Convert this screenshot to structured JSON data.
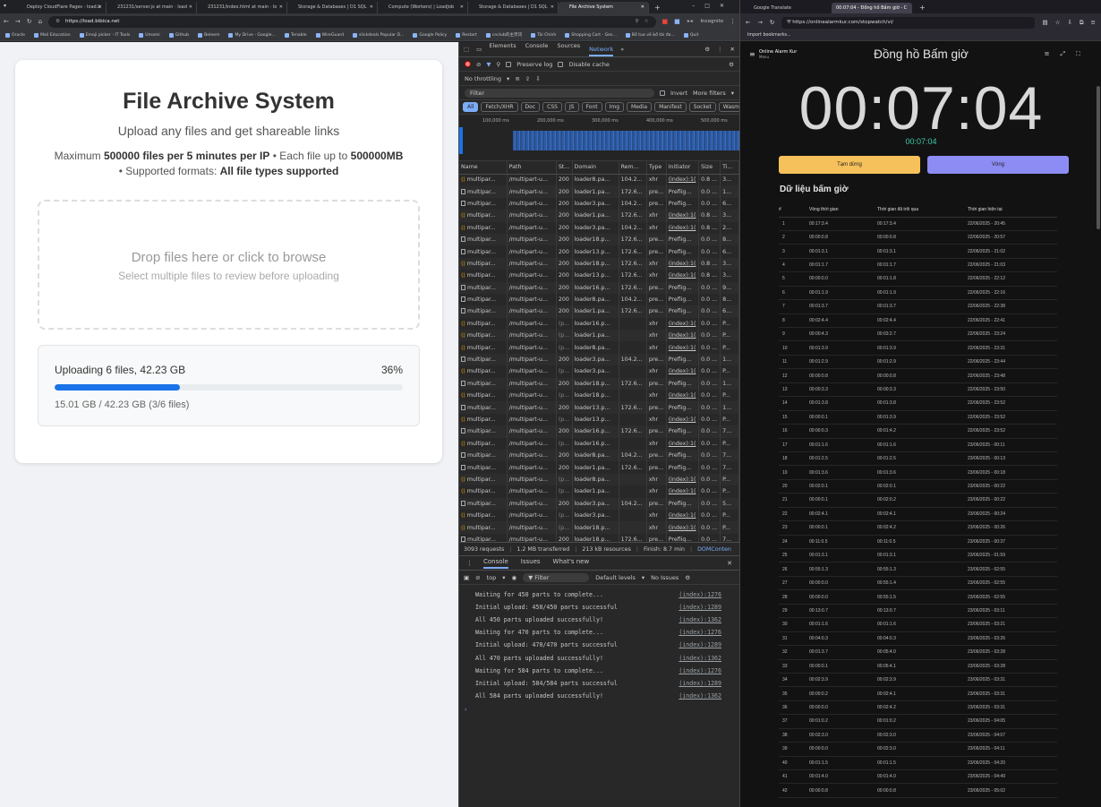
{
  "browser": {
    "tabs": [
      {
        "label": "Deploy CloudFlare Pages - load.b"
      },
      {
        "label": "231231/server.js at main · load"
      },
      {
        "label": "231231/index.html at main · lo"
      },
      {
        "label": "Storage & Databases | D1 SQL"
      },
      {
        "label": "Compute (Workers) | LoadJob"
      },
      {
        "label": "Storage & Databases | D1 SQL"
      },
      {
        "label": "File Archive System",
        "active": true
      }
    ],
    "url": "https://load.bibica.net",
    "incognito": "Incognito",
    "bookmarks": [
      "Oracle",
      "Mail Education",
      "Emoji picker - IT Tools",
      "Umami",
      "Github",
      "Beleem",
      "My Drive - Google...",
      "Tenable",
      "WireGuard",
      "slickdeals Popular D...",
      "Google Policy",
      "Restart",
      "cnclub的主页讯",
      "Tài Chính",
      "Shopping Cart - Ges...",
      "Bổ tua về bổ tài đa...",
      "Quit"
    ]
  },
  "app": {
    "title": "File Archive System",
    "subtitle": "Upload any files and get shareable links",
    "info_pre": "Maximum ",
    "info_files": "500000 files per 5 minutes per IP",
    "info_mid": " • Each file up to ",
    "info_size": "500000MB",
    "info_post": " • Supported formats: ",
    "info_formats": "All file types supported",
    "drop_title": "Drop files here or click to browse",
    "drop_sub": "Select multiple files to review before uploading",
    "progress_label": "Uploading 6 files, 42.23 GB",
    "progress_percent": "36%",
    "progress_value": 0.36,
    "progress_detail": "15.01 GB / 42.23 GB (3/6 files)"
  },
  "devtools": {
    "tabs": [
      "Elements",
      "Console",
      "Sources",
      "Network"
    ],
    "active_tab": "Network",
    "preserve_log": "Preserve log",
    "disable_cache": "Disable cache",
    "throttling": "No throttling",
    "filter_placeholder": "Filter",
    "invert": "Invert",
    "more_filters": "More filters",
    "type_filters": [
      "All",
      "Fetch/XHR",
      "Doc",
      "CSS",
      "JS",
      "Font",
      "Img",
      "Media",
      "Manifest",
      "Socket",
      "Wasm"
    ],
    "timeline_ticks": [
      "100,000 ms",
      "200,000 ms",
      "300,000 ms",
      "400,000 ms",
      "500,000 ms"
    ],
    "columns": [
      "Name",
      "Path",
      "St...",
      "Domain",
      "Rem...",
      "Type",
      "Initiator",
      "Size",
      "Ti..."
    ],
    "rows": [
      [
        "multipar...",
        "/multipart-u...",
        "200",
        "loader8.pa...",
        "104.2...",
        "xhr",
        "(index):1(",
        "0.8 ...",
        "3..."
      ],
      [
        "multipar...",
        "/multipart-u...",
        "200",
        "loader1.pa...",
        "172.6...",
        "pre...",
        "Preflig...",
        "0.0 ...",
        "1..."
      ],
      [
        "multipar...",
        "/multipart-u...",
        "200",
        "loader3.pa...",
        "104.2...",
        "pre...",
        "Preflig...",
        "0.0 ...",
        "6..."
      ],
      [
        "multipar...",
        "/multipart-u...",
        "200",
        "loader1.pa...",
        "172.6...",
        "xhr",
        "(index):1(",
        "0.8 ...",
        "3..."
      ],
      [
        "multipar...",
        "/multipart-u...",
        "200",
        "loader3.pa...",
        "104.2...",
        "xhr",
        "(index):1(",
        "0.8 ...",
        "2..."
      ],
      [
        "multipar...",
        "/multipart-u...",
        "200",
        "loader18.p...",
        "172.6...",
        "pre...",
        "Preflig...",
        "0.0 ...",
        "8..."
      ],
      [
        "multipar...",
        "/multipart-u...",
        "200",
        "loader13.p...",
        "172.6...",
        "pre...",
        "Preflig...",
        "0.0 ...",
        "6..."
      ],
      [
        "multipar...",
        "/multipart-u...",
        "200",
        "loader18.p...",
        "172.6...",
        "xhr",
        "(index):1(",
        "0.8 ...",
        "3..."
      ],
      [
        "multipar...",
        "/multipart-u...",
        "200",
        "loader13.p...",
        "172.6...",
        "xhr",
        "(index):1(",
        "0.8 ...",
        "3..."
      ],
      [
        "multipar...",
        "/multipart-u...",
        "200",
        "loader16.p...",
        "172.6...",
        "pre...",
        "Preflig...",
        "0.0 ...",
        "9..."
      ],
      [
        "multipar...",
        "/multipart-u...",
        "200",
        "loader8.pa...",
        "104.2...",
        "pre...",
        "Preflig...",
        "0.0 ...",
        "8..."
      ],
      [
        "multipar...",
        "/multipart-u...",
        "200",
        "loader1.pa...",
        "172.6...",
        "pre...",
        "Preflig...",
        "0.0 ...",
        "6..."
      ],
      [
        "multipar...",
        "/multipart-u...",
        "(p...",
        "loader16.p...",
        "",
        "xhr",
        "(index):1(",
        "0.0 ...",
        "P..."
      ],
      [
        "multipar...",
        "/multipart-u...",
        "(p...",
        "loader1.pa...",
        "",
        "xhr",
        "(index):1(",
        "0.0 ...",
        "P..."
      ],
      [
        "multipar...",
        "/multipart-u...",
        "(p...",
        "loader8.pa...",
        "",
        "xhr",
        "(index):1(",
        "0.0 ...",
        "P..."
      ],
      [
        "multipar...",
        "/multipart-u...",
        "200",
        "loader3.pa...",
        "104.2...",
        "pre...",
        "Preflig...",
        "0.0 ...",
        "1..."
      ],
      [
        "multipar...",
        "/multipart-u...",
        "(p...",
        "loader3.pa...",
        "",
        "xhr",
        "(index):1(",
        "0.0 ...",
        "P..."
      ],
      [
        "multipar...",
        "/multipart-u...",
        "200",
        "loader18.p...",
        "172.6...",
        "pre...",
        "Preflig...",
        "0.0 ...",
        "1..."
      ],
      [
        "multipar...",
        "/multipart-u...",
        "(p...",
        "loader18.p...",
        "",
        "xhr",
        "(index):1(",
        "0.0 ...",
        "P..."
      ],
      [
        "multipar...",
        "/multipart-u...",
        "200",
        "loader13.p...",
        "172.6...",
        "pre...",
        "Preflig...",
        "0.0 ...",
        "1..."
      ],
      [
        "multipar...",
        "/multipart-u...",
        "(p...",
        "loader13.p...",
        "",
        "xhr",
        "(index):1(",
        "0.0 ...",
        "P..."
      ],
      [
        "multipar...",
        "/multipart-u...",
        "200",
        "loader16.p...",
        "172.6...",
        "pre...",
        "Preflig...",
        "0.0 ...",
        "7..."
      ],
      [
        "multipar...",
        "/multipart-u...",
        "(p...",
        "loader16.p...",
        "",
        "xhr",
        "(index):1(",
        "0.0 ...",
        "P..."
      ],
      [
        "multipar...",
        "/multipart-u...",
        "200",
        "loader8.pa...",
        "104.2...",
        "pre...",
        "Preflig...",
        "0.0 ...",
        "7..."
      ],
      [
        "multipar...",
        "/multipart-u...",
        "200",
        "loader1.pa...",
        "172.6...",
        "pre...",
        "Preflig...",
        "0.0 ...",
        "7..."
      ],
      [
        "multipar...",
        "/multipart-u...",
        "(p...",
        "loader8.pa...",
        "",
        "xhr",
        "(index):1(",
        "0.0 ...",
        "P..."
      ],
      [
        "multipar...",
        "/multipart-u...",
        "(p...",
        "loader1.pa...",
        "",
        "xhr",
        "(index):1(",
        "0.0 ...",
        "P..."
      ],
      [
        "multipar...",
        "/multipart-u...",
        "200",
        "loader3.pa...",
        "104.2...",
        "pre...",
        "Preflig...",
        "0.0 ...",
        "5..."
      ],
      [
        "multipar...",
        "/multipart-u...",
        "(p...",
        "loader3.pa...",
        "",
        "xhr",
        "(index):1(",
        "0.0 ...",
        "P..."
      ],
      [
        "multipar...",
        "/multipart-u...",
        "(p...",
        "loader18.p...",
        "",
        "xhr",
        "(index):1(",
        "0.0 ...",
        "P..."
      ],
      [
        "multipar...",
        "/multipart-u...",
        "200",
        "loader18.p...",
        "172.6...",
        "pre...",
        "Preflig...",
        "0.0 ...",
        "7..."
      ]
    ],
    "summary": [
      "3093 requests",
      "1.2 MB transferred",
      "213 kB resources",
      "Finish: 8.7 min",
      "DOMConten"
    ],
    "console_tabs": [
      "Console",
      "Issues",
      "What's new"
    ],
    "console_context": "top",
    "console_filter": "Filter",
    "default_levels": "Default levels",
    "no_issues": "No Issues",
    "logs": [
      {
        "msg": "Waiting for 450 parts to complete...",
        "src": "(index):1276"
      },
      {
        "msg": "Initial upload: 450/450 parts successful",
        "src": "(index):1289"
      },
      {
        "msg": "All 450 parts uploaded successfully!",
        "src": "(index):1362"
      },
      {
        "msg": "Waiting for 470 parts to complete...",
        "src": "(index):1276"
      },
      {
        "msg": "Initial upload: 470/470 parts successful",
        "src": "(index):1289"
      },
      {
        "msg": "All 470 parts uploaded successfully!",
        "src": "(index):1362"
      },
      {
        "msg": "Waiting for 584 parts to complete...",
        "src": "(index):1276"
      },
      {
        "msg": "Initial upload: 584/584 parts successful",
        "src": "(index):1289"
      },
      {
        "msg": "All 584 parts uploaded successfully!",
        "src": "(index):1362"
      }
    ]
  },
  "stopwatch": {
    "tabs": [
      "Google Translate",
      "00:07:04 - Đồng hồ Bấm giờ - C"
    ],
    "url": "https://onlinealarmkur.com/stopwatch/vi/",
    "import_bookmarks": "Import bookmarks...",
    "brand": "Online Alarm Kur",
    "menu": "Menu",
    "title": "Đồng hồ Bấm giờ",
    "time": "00:07:04",
    "time_small": "00:07:04",
    "pause_label": "Tạm dừng",
    "lap_label": "Vòng",
    "laps_heading": "Dữ liệu bấm giờ",
    "columns": [
      "#",
      "Vòng thời gian",
      "Thời gian đã trôi qua",
      "Thời gian hiện tại"
    ],
    "laps": [
      [
        "1",
        "00:17:3.4",
        "00:17:3.4",
        "22/06/2025 - 20:45"
      ],
      [
        "2",
        "00:00:0.8",
        "00:00:0.8",
        "22/06/2025 - 20:57"
      ],
      [
        "3",
        "00:01:3.1",
        "00:01:3.1",
        "22/06/2025 - 21:02"
      ],
      [
        "4",
        "00:01:1.7",
        "00:01:1.7",
        "22/06/2025 - 21:03"
      ],
      [
        "5",
        "00:00:0.0",
        "00:01:1.8",
        "22/06/2025 - 22:12"
      ],
      [
        "6",
        "00:01:1.9",
        "00:01:1.9",
        "22/06/2025 - 22:16"
      ],
      [
        "7",
        "00:01:3.7",
        "00:01:3.7",
        "22/06/2025 - 22:38"
      ],
      [
        "8",
        "00:02:4.4",
        "00:02:4.4",
        "22/06/2025 - 22:41"
      ],
      [
        "9",
        "00:00:4.3",
        "00:03:2.7",
        "22/06/2025 - 23:24"
      ],
      [
        "10",
        "00:01:3.9",
        "00:01:3.9",
        "22/06/2025 - 23:31"
      ],
      [
        "11",
        "00:01:2.9",
        "00:01:2.9",
        "22/06/2025 - 23:44"
      ],
      [
        "12",
        "00:00:0.8",
        "00:00:0.8",
        "22/06/2025 - 23:48"
      ],
      [
        "13",
        "00:00:3.3",
        "00:00:3.3",
        "22/06/2025 - 23:50"
      ],
      [
        "14",
        "00:01:3.8",
        "00:01:3.8",
        "22/06/2025 - 23:52"
      ],
      [
        "15",
        "00:00:0.1",
        "00:01:3.9",
        "22/06/2025 - 23:52"
      ],
      [
        "16",
        "00:00:0.3",
        "00:01:4.2",
        "22/06/2025 - 23:52"
      ],
      [
        "17",
        "00:01:1.6",
        "00:01:1.6",
        "23/06/2025 - 00:11"
      ],
      [
        "18",
        "00:01:2.5",
        "00:01:2.5",
        "23/06/2025 - 00:13"
      ],
      [
        "19",
        "00:01:3.6",
        "00:01:3.6",
        "23/06/2025 - 00:18"
      ],
      [
        "20",
        "00:02:0.1",
        "00:02:0.1",
        "23/06/2025 - 00:22"
      ],
      [
        "21",
        "00:00:0.1",
        "00:02:0.2",
        "23/06/2025 - 00:22"
      ],
      [
        "22",
        "00:02:4.1",
        "00:02:4.1",
        "23/06/2025 - 00:24"
      ],
      [
        "23",
        "00:00:0.1",
        "00:02:4.2",
        "23/06/2025 - 00:26"
      ],
      [
        "24",
        "00:11:0.5",
        "00:11:0.5",
        "23/06/2025 - 00:37"
      ],
      [
        "25",
        "00:01:3.1",
        "00:01:3.1",
        "23/06/2025 - 01:59"
      ],
      [
        "26",
        "00:55:1.3",
        "00:55:1.3",
        "23/06/2025 - 02:55"
      ],
      [
        "27",
        "00:00:0.0",
        "00:55:1.4",
        "23/06/2025 - 02:55"
      ],
      [
        "28",
        "00:00:0.0",
        "00:55:1.5",
        "23/06/2025 - 02:55"
      ],
      [
        "29",
        "00:13:0.7",
        "00:13:0.7",
        "23/06/2025 - 03:11"
      ],
      [
        "30",
        "00:01:1.6",
        "00:01:1.6",
        "23/06/2025 - 03:21"
      ],
      [
        "31",
        "00:04:0.3",
        "00:04:0.3",
        "23/06/2025 - 03:26"
      ],
      [
        "32",
        "00:01:3.7",
        "00:05:4.0",
        "23/06/2025 - 03:28"
      ],
      [
        "33",
        "00:00:0.1",
        "00:05:4.1",
        "23/06/2025 - 03:28"
      ],
      [
        "34",
        "00:02:3.9",
        "00:02:3.9",
        "23/06/2025 - 03:31"
      ],
      [
        "35",
        "00:00:0.2",
        "00:02:4.1",
        "23/06/2025 - 03:31"
      ],
      [
        "36",
        "00:00:0.0",
        "00:02:4.2",
        "23/06/2025 - 03:31"
      ],
      [
        "37",
        "00:01:0.2",
        "00:01:0.2",
        "23/06/2025 - 04:05"
      ],
      [
        "38",
        "00:02:3.0",
        "00:02:3.0",
        "23/06/2025 - 04:07"
      ],
      [
        "39",
        "00:00:0.0",
        "00:02:3.0",
        "23/06/2025 - 04:11"
      ],
      [
        "40",
        "00:01:1.5",
        "00:01:1.5",
        "23/06/2025 - 04:20"
      ],
      [
        "41",
        "00:01:4.0",
        "00:01:4.0",
        "23/06/2025 - 04:49"
      ],
      [
        "42",
        "00:00:0.8",
        "00:00:0.8",
        "23/06/2025 - 05:02"
      ]
    ]
  }
}
